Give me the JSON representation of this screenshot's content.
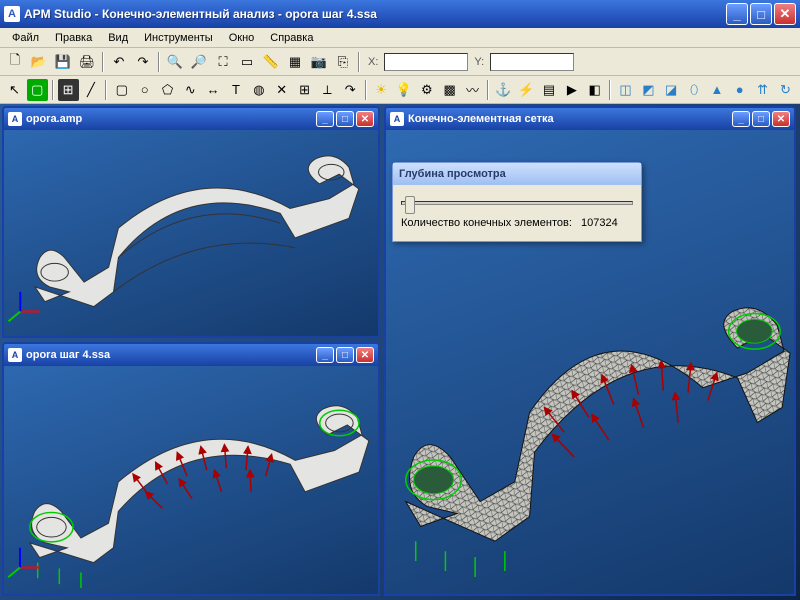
{
  "app": {
    "icon_letter": "A",
    "title": "APM Studio - Конечно-элементный анализ - opora шаг 4.ssa"
  },
  "menu": {
    "file": "Файл",
    "edit": "Правка",
    "view": "Вид",
    "tools": "Инструменты",
    "window": "Окно",
    "help": "Справка"
  },
  "toolbar1": {
    "coord_x_label": "X:",
    "coord_y_label": "Y:"
  },
  "windows": {
    "top_left": {
      "title": "opora.amp",
      "icon_letter": "A"
    },
    "bottom_left": {
      "title": "opora шаг 4.ssa",
      "icon_letter": "A"
    },
    "right": {
      "title": "Конечно-элементная сетка",
      "icon_letter": "A"
    }
  },
  "dialog": {
    "title": "Глубина просмотра",
    "count_label": "Количество конечных элементов:",
    "count_value": "107324"
  },
  "icons": {
    "new": "🗋",
    "open": "📂",
    "save": "💾",
    "print": "🖨",
    "undo": "↶",
    "redo": "↷",
    "zoom_in": "🔍",
    "zoom_out": "🔎",
    "zoom_fit": "⛶",
    "zoom_win": "▭",
    "ruler": "📏",
    "layers": "▦",
    "camera": "📷",
    "copy": "⎘",
    "cursor": "↖",
    "line": "╱",
    "box": "▢",
    "circ": "○",
    "poly": "⬠",
    "spline": "∿",
    "dim": "↔",
    "text": "T",
    "fill": "◍",
    "del": "✕",
    "snap": "⊞",
    "ortho": "⟂",
    "sun": "☀",
    "bulb": "💡",
    "gear": "⚙",
    "mesh": "▩",
    "spring": "〰",
    "anchor": "⚓",
    "bolt": "⚡",
    "mat": "▤",
    "run": "▶",
    "res": "◧",
    "cube1": "◫",
    "cube2": "◩",
    "cube3": "◪",
    "cyl": "⬯",
    "cone": "▲",
    "sph": "●",
    "ext": "⇈",
    "rev": "↻"
  }
}
